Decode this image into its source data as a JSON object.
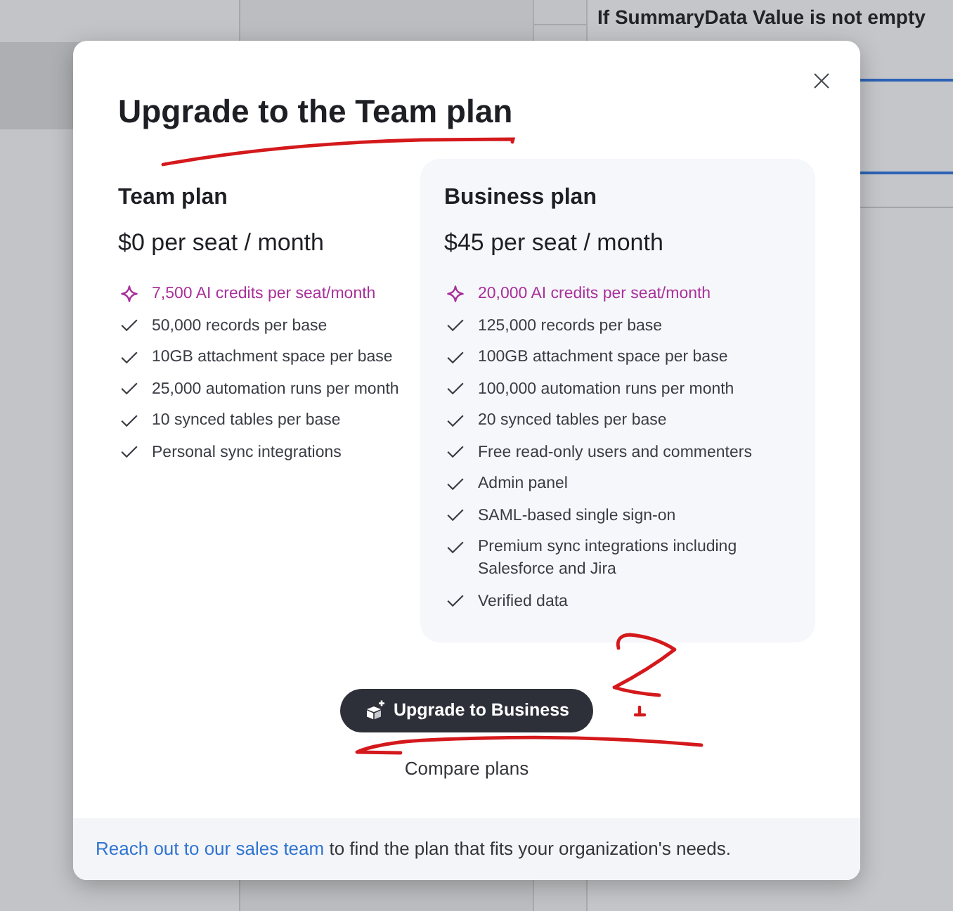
{
  "background": {
    "label": "If SummaryData Value is not empty"
  },
  "dialog": {
    "title": "Upgrade to the Team plan",
    "plans": [
      {
        "name": "Team plan",
        "price": "$0 per seat / month",
        "highlighted": false,
        "features": [
          {
            "kind": "ai",
            "text": "7,500 AI credits per seat/month"
          },
          {
            "kind": "check",
            "text": "50,000 records per base"
          },
          {
            "kind": "check",
            "text": "10GB attachment space per base"
          },
          {
            "kind": "check",
            "text": "25,000 automation runs per month"
          },
          {
            "kind": "check",
            "text": "10 synced tables per base"
          },
          {
            "kind": "check",
            "text": "Personal sync integrations"
          }
        ]
      },
      {
        "name": "Business plan",
        "price": "$45 per seat / month",
        "highlighted": true,
        "features": [
          {
            "kind": "ai",
            "text": "20,000 AI credits per seat/month"
          },
          {
            "kind": "check",
            "text": "125,000 records per base"
          },
          {
            "kind": "check",
            "text": "100GB attachment space per base"
          },
          {
            "kind": "check",
            "text": "100,000 automation runs per month"
          },
          {
            "kind": "check",
            "text": "20 synced tables per base"
          },
          {
            "kind": "check",
            "text": "Free read-only users and commenters"
          },
          {
            "kind": "check",
            "text": "Admin panel"
          },
          {
            "kind": "check",
            "text": "SAML-based single sign-on"
          },
          {
            "kind": "check",
            "text": "Premium sync integrations including Salesforce and Jira"
          },
          {
            "kind": "check",
            "text": "Verified data"
          }
        ]
      }
    ],
    "upgrade_button": "Upgrade to Business",
    "compare_link": "Compare plans",
    "footer": {
      "link": "Reach out to our sales team",
      "text": "to find the plan that fits your organization's needs."
    }
  }
}
